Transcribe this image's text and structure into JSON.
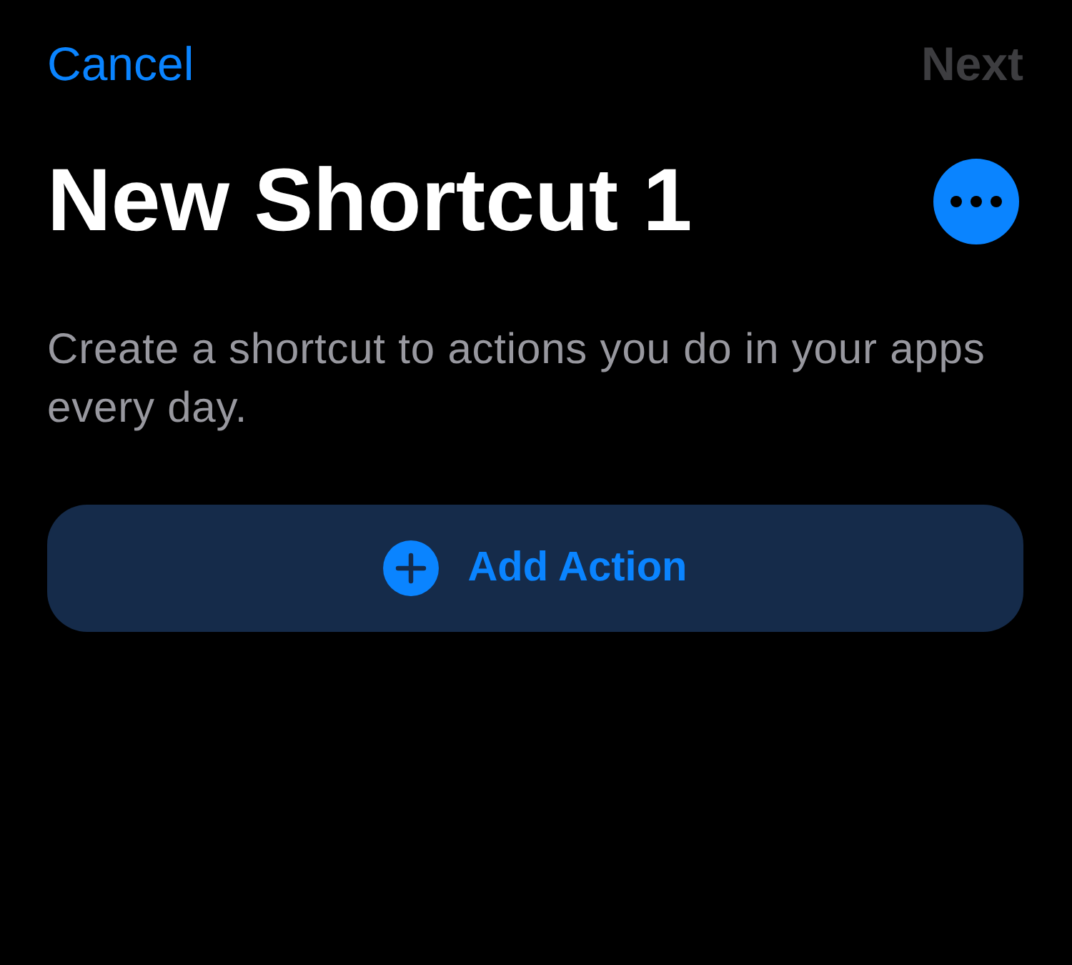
{
  "nav_bar": {
    "cancel": {
      "label": "Cancel"
    },
    "next": {
      "label": "Next",
      "disabled": true
    }
  },
  "header": {
    "title": "New Shortcut 1"
  },
  "description": "Create a shortcut to actions you do in your apps every day.",
  "add_action_button": {
    "label": "Add Action"
  }
}
